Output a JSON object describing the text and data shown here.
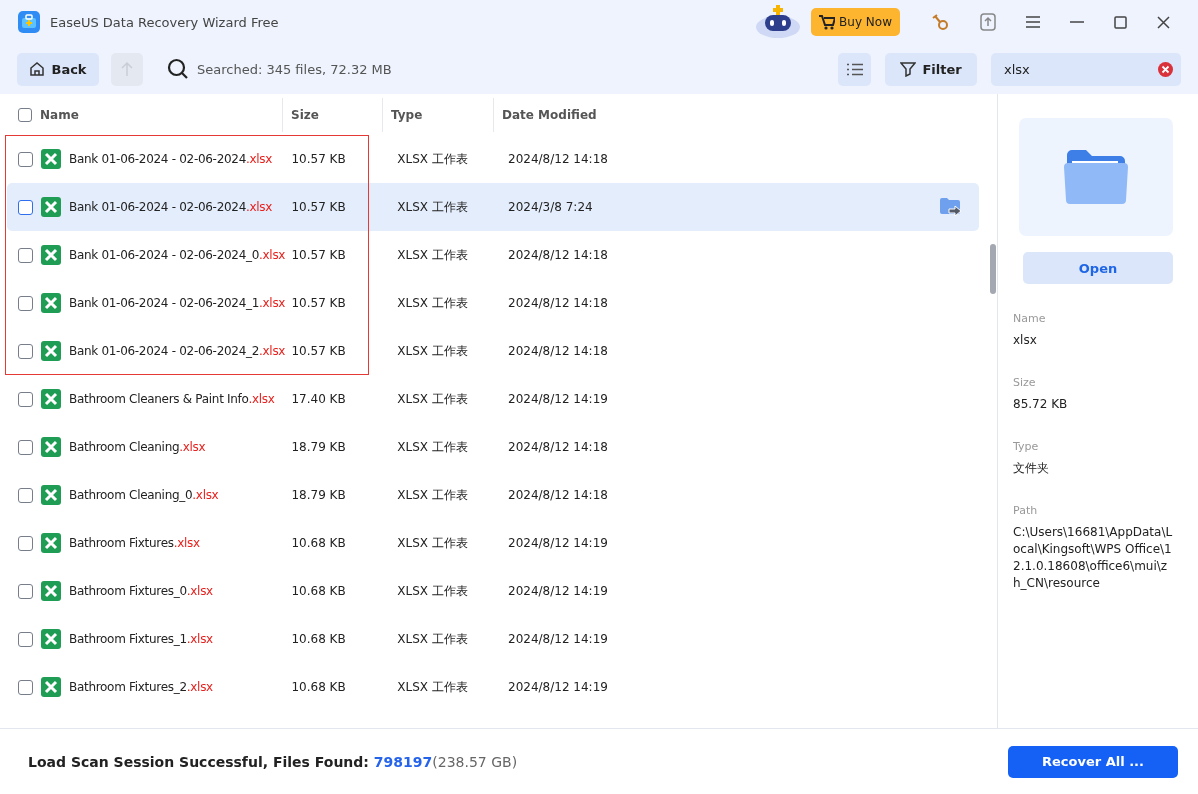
{
  "window": {
    "title": "EaseUS Data Recovery Wizard Free",
    "buy_button": "Buy Now"
  },
  "toolbar": {
    "back": "Back",
    "up_disabled": true,
    "search_summary": "Searched: 345 files, 72.32 MB",
    "filter": "Filter",
    "search_value": "xlsx"
  },
  "table": {
    "columns": [
      "Name",
      "Size",
      "Type",
      "Date Modified"
    ],
    "all_checked": false,
    "highlighted_rows": [
      {
        "name": "Bank 01-06-2024 - 02-06-2024",
        "extension": ".xlsx",
        "size": "10.57 KB",
        "type": "XLSX 工作表",
        "date": "2024/8/12 14:18",
        "checked": false,
        "selected": false
      },
      {
        "name": "Bank 01-06-2024 - 02-06-2024",
        "extension": ".xlsx",
        "size": "10.57 KB",
        "type": "XLSX 工作表",
        "date": "2024/3/8 7:24",
        "checked": false,
        "selected": true
      },
      {
        "name": "Bank 01-06-2024 - 02-06-2024_0",
        "extension": ".xlsx",
        "size": "10.57 KB",
        "type": "XLSX 工作表",
        "date": "2024/8/12 14:18",
        "checked": false,
        "selected": false
      },
      {
        "name": "Bank 01-06-2024 - 02-06-2024_1",
        "extension": ".xlsx",
        "size": "10.57 KB",
        "type": "XLSX 工作表",
        "date": "2024/8/12 14:18",
        "checked": false,
        "selected": false
      },
      {
        "name": "Bank 01-06-2024 - 02-06-2024_2",
        "extension": ".xlsx",
        "size": "10.57 KB",
        "type": "XLSX 工作表",
        "date": "2024/8/12 14:18",
        "checked": false,
        "selected": false
      }
    ],
    "rows": [
      {
        "name": "Bathroom Cleaners & Paint Info",
        "extension": ".xlsx",
        "size": "17.40 KB",
        "type": "XLSX 工作表",
        "date": "2024/8/12 14:19",
        "checked": false,
        "selected": false
      },
      {
        "name": "Bathroom Cleaning",
        "extension": ".xlsx",
        "size": "18.79 KB",
        "type": "XLSX 工作表",
        "date": "2024/8/12 14:18",
        "checked": false,
        "selected": false
      },
      {
        "name": "Bathroom Cleaning_0",
        "extension": ".xlsx",
        "size": "18.79 KB",
        "type": "XLSX 工作表",
        "date": "2024/8/12 14:18",
        "checked": false,
        "selected": false
      },
      {
        "name": "Bathroom Fixtures",
        "extension": ".xlsx",
        "size": "10.68 KB",
        "type": "XLSX 工作表",
        "date": "2024/8/12 14:19",
        "checked": false,
        "selected": false
      },
      {
        "name": "Bathroom Fixtures_0",
        "extension": ".xlsx",
        "size": "10.68 KB",
        "type": "XLSX 工作表",
        "date": "2024/8/12 14:19",
        "checked": false,
        "selected": false
      },
      {
        "name": "Bathroom Fixtures_1",
        "extension": ".xlsx",
        "size": "10.68 KB",
        "type": "XLSX 工作表",
        "date": "2024/8/12 14:19",
        "checked": false,
        "selected": false
      },
      {
        "name": "Bathroom Fixtures_2",
        "extension": ".xlsx",
        "size": "10.68 KB",
        "type": "XLSX 工作表",
        "date": "2024/8/12 14:19",
        "checked": false,
        "selected": false
      }
    ]
  },
  "details": {
    "open_button": "Open",
    "fields": [
      {
        "label": "Name",
        "value": "xlsx"
      },
      {
        "label": "Size",
        "value": "85.72 KB"
      },
      {
        "label": "Type",
        "value": "文件夹"
      },
      {
        "label": "Path",
        "value": "C:\\Users\\16681\\AppData\\Local\\Kingsoft\\WPS Office\\12.1.0.18608\\office6\\mui\\zh_CN\\resource"
      }
    ]
  },
  "status_bar": {
    "message": "Load Scan Session Successful, Files Found: ",
    "count": "798197",
    "total_size": "(238.57 GB)",
    "recover_button": "Recover All ..."
  }
}
